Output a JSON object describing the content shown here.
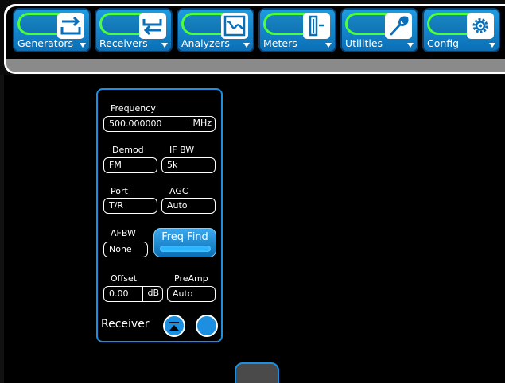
{
  "menu": [
    {
      "label": "Generators",
      "icon": "generators-icon"
    },
    {
      "label": "Receivers",
      "icon": "receivers-icon"
    },
    {
      "label": "Analyzers",
      "icon": "analyzers-icon"
    },
    {
      "label": "Meters",
      "icon": "meters-icon"
    },
    {
      "label": "Utilities",
      "icon": "wrench-icon"
    },
    {
      "label": "Config",
      "icon": "gear-icon"
    }
  ],
  "colors": {
    "accent": "#1d8fe0",
    "highlight": "#4dff3a",
    "button": "#0a6fb6"
  },
  "receiver": {
    "frequency_label": "Frequency",
    "frequency_value": "500.000000",
    "frequency_unit": "MHz",
    "demod_label": "Demod",
    "demod_value": "FM",
    "ifbw_label": "IF BW",
    "ifbw_value": "5k",
    "port_label": "Port",
    "port_value": "T/R",
    "agc_label": "AGC",
    "agc_value": "Auto",
    "afbw_label": "AFBW",
    "afbw_value": "None",
    "freq_find_label": "Freq Find",
    "offset_label": "Offset",
    "offset_value": "0.00",
    "offset_unit": "dB",
    "preamp_label": "PreAmp",
    "preamp_value": "Auto",
    "title": "Receiver"
  }
}
